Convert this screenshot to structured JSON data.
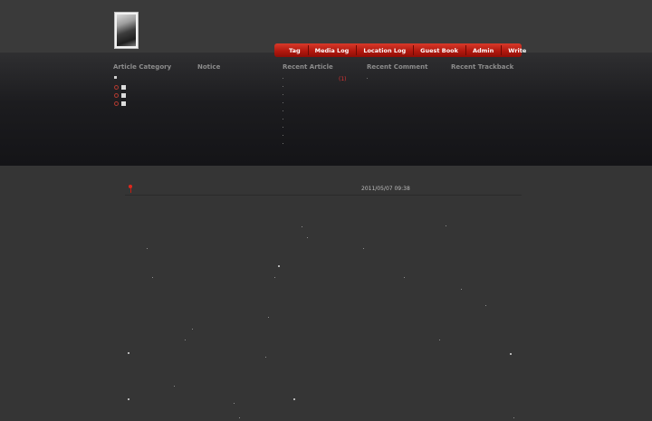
{
  "nav": {
    "items": [
      "Tag",
      "Media Log",
      "Location Log",
      "Guest Book",
      "Admin",
      "Write"
    ]
  },
  "sidebar": {
    "titles": {
      "category": "Article Category",
      "notice": "Notice",
      "recent_article": "Recent Article",
      "recent_comment": "Recent Comment",
      "recent_trackback": "Recent Trackback"
    },
    "recent_article_count": "(1)"
  },
  "post": {
    "date": "2011/05/07 09:38"
  },
  "colors": {
    "accent": "#c41d12",
    "background": "#353535",
    "panel": "#1c1c1f"
  },
  "icons": [
    "logo-image",
    "tree-icon",
    "category-ring-icon",
    "pin-icon"
  ]
}
